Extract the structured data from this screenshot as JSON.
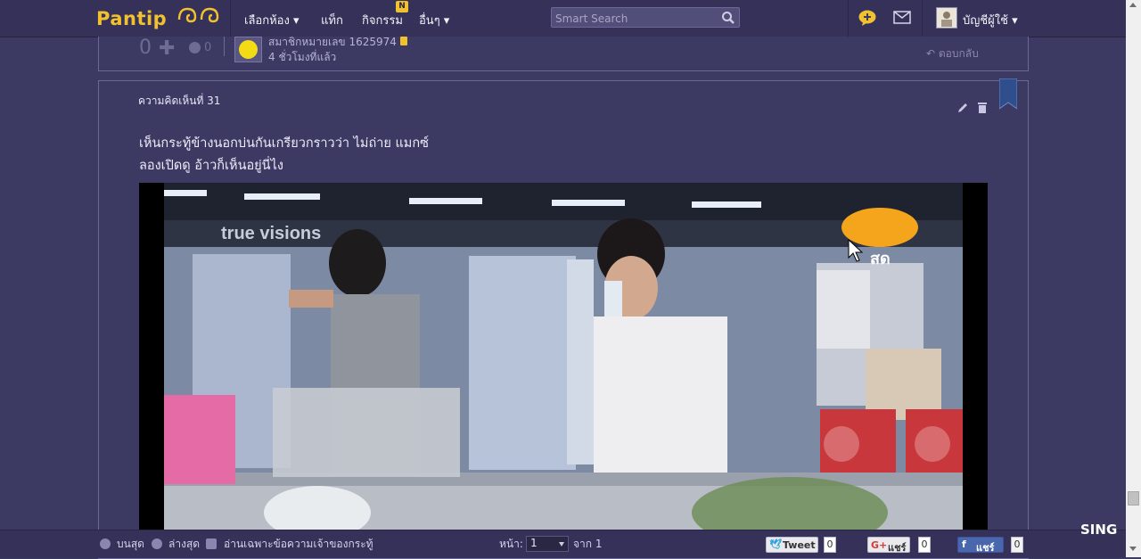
{
  "header": {
    "logo_text": "Pantip",
    "nav": [
      "เลือกห้อง ▾",
      "แท็ก",
      "กิจกรรม",
      "อื่นๆ ▾"
    ],
    "activity_badge": "N",
    "search_placeholder": "Smart Search",
    "account_label": "บัญชีผู้ใช้ ▾"
  },
  "prev_comment": {
    "vote_count": "0",
    "emotion_count": "0",
    "member": "สมาชิกหมายเลข 1625974",
    "time_ago": "4 ชั่วโมงที่แล้ว",
    "reply_label": "ตอบกลับ"
  },
  "comment": {
    "number_label": "ความคิดเห็นที่ 31",
    "lines": [
      "เห็นกระทู้ข้างนอกบ่นกันเกรียวกราวว่า  ไม่ถ่าย แมกซ์",
      "ลองเปิดดู  อ้าวก็เห็นอยู่นี่ไง"
    ],
    "video": {
      "channel_logo": "true visions",
      "live_label": "สด"
    }
  },
  "footer": {
    "top_label": "บนสุด",
    "bottom_label": "ล่างสุด",
    "owner_only_label": "อ่านเฉพาะข้อความเจ้าของกระทู้",
    "page_label": "หน้า:",
    "page_value": "1",
    "of_label": "จาก 1",
    "tweet_label": "Tweet",
    "tweet_count": "0",
    "gplus_label": "แชร์",
    "gplus_count": "0",
    "fb_label": "แชร์",
    "fb_count": "0"
  },
  "overlay_text": "SING",
  "colors": {
    "background": "#3c3963",
    "topbar": "#353158",
    "brand_yellow": "#f2c12e"
  }
}
